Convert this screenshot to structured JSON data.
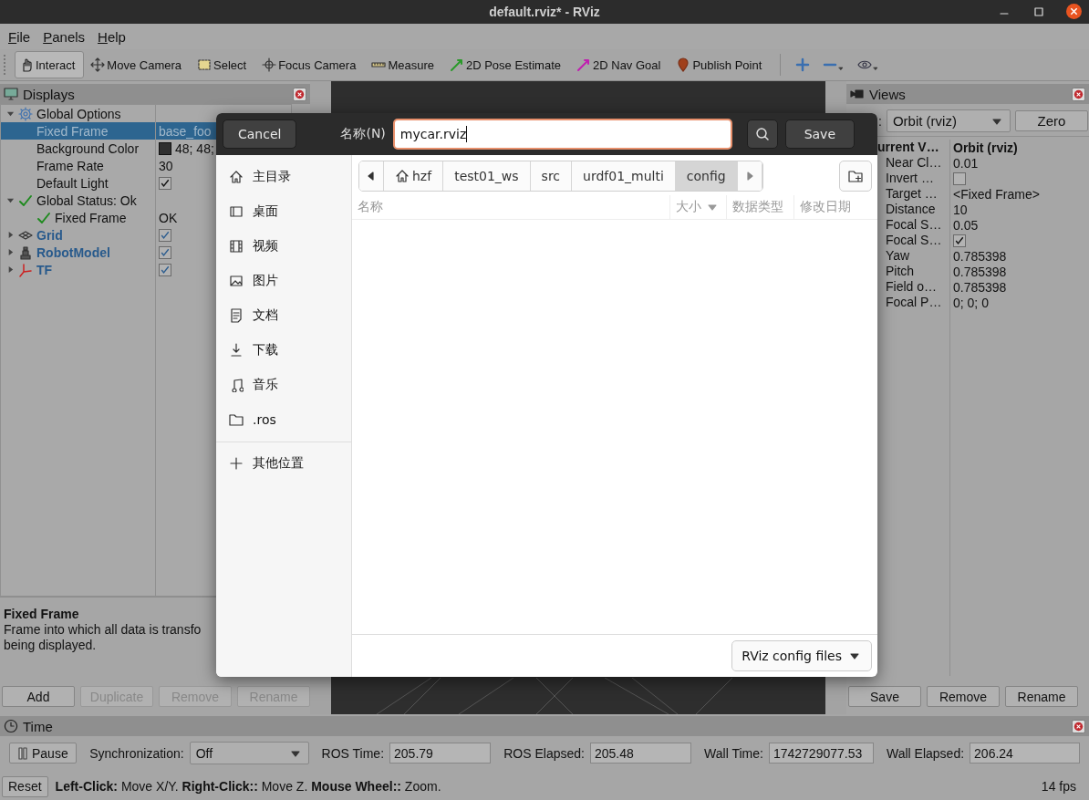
{
  "window": {
    "title": "default.rviz* - RViz"
  },
  "menu": [
    "File",
    "Panels",
    "Help"
  ],
  "toolbar": [
    {
      "label": "Interact",
      "selected": true
    },
    {
      "label": "Move Camera",
      "selected": false
    },
    {
      "label": "Select",
      "selected": false
    },
    {
      "label": "Focus Camera",
      "selected": false
    },
    {
      "label": "Measure",
      "selected": false
    },
    {
      "label": "2D Pose Estimate",
      "selected": false
    },
    {
      "label": "2D Nav Goal",
      "selected": false
    },
    {
      "label": "Publish Point",
      "selected": false
    }
  ],
  "displays": {
    "title": "Displays",
    "tree": [
      {
        "label": "Global Options",
        "kind": "group",
        "expanded": true,
        "selected": false,
        "children": [
          {
            "label": "Fixed Frame",
            "kind": "property",
            "value": "base_foo",
            "selected": true
          },
          {
            "label": "Background Color",
            "kind": "property",
            "value": "48; 48;",
            "color": "#303030",
            "selected": false
          },
          {
            "label": "Frame Rate",
            "kind": "property",
            "value": "30",
            "selected": false
          },
          {
            "label": "Default Light",
            "kind": "property",
            "checked": true,
            "selected": false
          }
        ]
      },
      {
        "label": "Global Status: Ok",
        "kind": "status",
        "expanded": true,
        "selected": false,
        "children": [
          {
            "label": "Fixed Frame",
            "kind": "status",
            "value": "OK",
            "selected": false
          }
        ]
      },
      {
        "label": "Grid",
        "kind": "display",
        "expanded": false,
        "checked": true,
        "selected": false
      },
      {
        "label": "RobotModel",
        "kind": "display",
        "expanded": false,
        "checked": true,
        "selected": false
      },
      {
        "label": "TF",
        "kind": "display",
        "expanded": false,
        "checked": true,
        "selected": false
      }
    ],
    "description": {
      "title": "Fixed Frame",
      "lines": [
        "Frame into which all data is transfo",
        "being displayed."
      ]
    },
    "buttons": [
      {
        "label": "Add",
        "disabled": false
      },
      {
        "label": "Duplicate",
        "disabled": true
      },
      {
        "label": "Remove",
        "disabled": true
      },
      {
        "label": "Rename",
        "disabled": true
      }
    ]
  },
  "views": {
    "title": "Views",
    "type_label": ":",
    "type": "Orbit (rviz)",
    "zero": "Zero",
    "header": {
      "label": "urrent V…",
      "value": "Orbit (rviz)"
    },
    "properties": [
      {
        "label": "Near Cl…",
        "value": "0.01"
      },
      {
        "label": "Invert …",
        "checked": false
      },
      {
        "label": "Target …",
        "value": "<Fixed Frame>"
      },
      {
        "label": "Distance",
        "value": "10"
      },
      {
        "label": "Focal S…",
        "value": "0.05"
      },
      {
        "label": "Focal S…",
        "checked": true
      },
      {
        "label": "Yaw",
        "value": "0.785398"
      },
      {
        "label": "Pitch",
        "value": "0.785398"
      },
      {
        "label": "Field o…",
        "value": "0.785398"
      },
      {
        "label": "Focal P…",
        "value": "0; 0; 0"
      }
    ],
    "buttons": [
      "Save",
      "Remove",
      "Rename"
    ]
  },
  "time": {
    "title": "Time",
    "pause": "Pause",
    "sync_label": "Synchronization:",
    "sync": "Off",
    "fields": [
      {
        "label": "ROS Time:",
        "value": "205.79"
      },
      {
        "label": "ROS Elapsed:",
        "value": "205.48"
      },
      {
        "label": "Wall Time:",
        "value": "1742729077.53"
      },
      {
        "label": "Wall Elapsed:",
        "value": "206.24"
      }
    ]
  },
  "status_bar": {
    "reset": "Reset",
    "hint": "**Left-Click:** Move X/Y. **Right-Click::** Move Z. **Mouse Wheel::** Zoom.",
    "fps": "14 fps"
  },
  "dialog": {
    "cancel": "Cancel",
    "name_label": "名称(N)",
    "name_value": "mycar.rviz",
    "save": "Save",
    "places": [
      "主目录",
      "桌面",
      "视频",
      "图片",
      "文档",
      "下载",
      "音乐",
      ".ros"
    ],
    "other": "其他位置",
    "path": [
      {
        "label": "hzf",
        "selected": false
      },
      {
        "label": "test01_ws",
        "selected": false
      },
      {
        "label": "src",
        "selected": false
      },
      {
        "label": "urdf01_multi",
        "selected": false
      },
      {
        "label": "config",
        "selected": true
      }
    ],
    "columns": [
      {
        "label": "名称",
        "sorted": false
      },
      {
        "label": "大小",
        "sorted": true
      },
      {
        "label": "数据类型",
        "sorted": false
      },
      {
        "label": "修改日期",
        "sorted": false
      }
    ],
    "filter": "RViz config files"
  }
}
